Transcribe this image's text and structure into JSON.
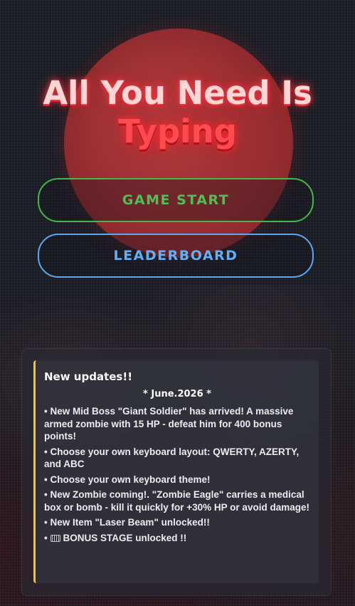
{
  "title": {
    "line1": "All You Need Is",
    "line2": "Typing"
  },
  "buttons": {
    "start": "GAME START",
    "leaderboard": "LEADERBOARD"
  },
  "updates": {
    "heading": "New updates!!",
    "date": "* June.2026 *",
    "items": [
      "• New Mid Boss \"Giant Soldier\" has arrived! A massive armed zombie with 15 HP - defeat him for 400 bonus points!",
      "• Choose your own keyboard layout: QWERTY, AZERTY, and ABC",
      "• Choose your own keyboard theme!",
      "• New Zombie coming!. \"Zombie Eagle\" carries a medical box or bomb - kill it quickly for +30% HP or avoid damage!",
      "• New Item \"Laser Beam\" unlocked!!",
      "BONUS STAGE unlocked !!"
    ],
    "last_item_bullet": "•",
    "last_item_icon": "keyboard-icon"
  },
  "colors": {
    "start": "#4fbf54",
    "leaderboard": "#62b0f4",
    "title_light": "#ffd6d6",
    "title_red": "#ff4a4f",
    "accent_bar": "#f5c52b"
  }
}
